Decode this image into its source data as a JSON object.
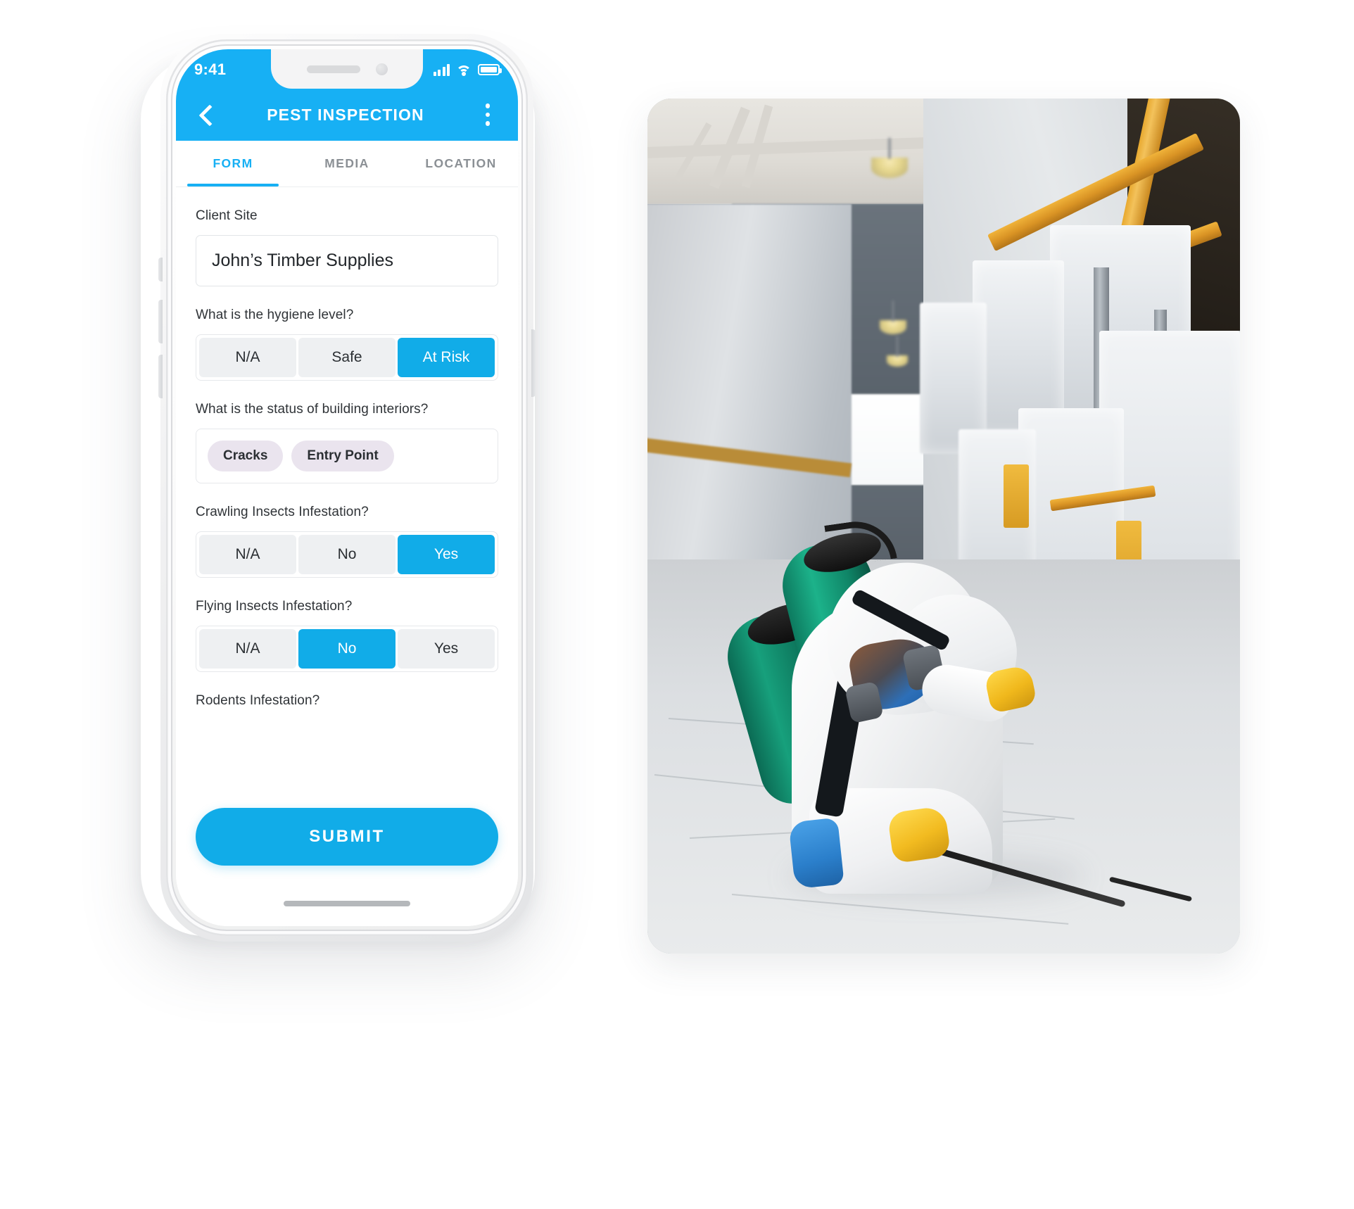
{
  "photo": {
    "alt_description": "Pest control worker in white protective coveralls, blue respirator mask and yellow gloves kneeling with a green sprayer tank, spraying along the base of pallet racking in a warehouse aisle",
    "scene": "warehouse-aisle",
    "colors": {
      "rack_yellow": "#e8a92f",
      "tank_green": "#17a07c",
      "glove_yellow": "#f2bb20",
      "mask_blue": "#2d6fb8",
      "floor_grey": "#dcdfe2"
    }
  },
  "phone": {
    "statusbar": {
      "time": "9:41",
      "icons": [
        "signal-bars-icon",
        "wifi-icon",
        "battery-icon"
      ]
    },
    "appbar": {
      "back_icon": "chevron-left-icon",
      "title": "PEST INSPECTION",
      "menu_icon": "kebab-menu-icon"
    },
    "tabs": [
      {
        "label": "FORM",
        "active": true
      },
      {
        "label": "MEDIA",
        "active": false
      },
      {
        "label": "LOCATION",
        "active": false
      }
    ],
    "form": {
      "fields": [
        {
          "type": "text",
          "label": "Client Site",
          "value": "John’s Timber Supplies",
          "placeholder": "Client Site"
        },
        {
          "type": "segmented",
          "label": "What is the hygiene level?",
          "options": [
            "N/A",
            "Safe",
            "At Risk"
          ],
          "selected": "At Risk"
        },
        {
          "type": "chips",
          "label": "What is the status of building interiors?",
          "chips": [
            "Cracks",
            "Entry Point"
          ]
        },
        {
          "type": "segmented",
          "label": "Crawling Insects Infestation?",
          "options": [
            "N/A",
            "No",
            "Yes"
          ],
          "selected": "Yes"
        },
        {
          "type": "segmented",
          "label": "Flying Insects Infestation?",
          "options": [
            "N/A",
            "No",
            "Yes"
          ],
          "selected": "No"
        },
        {
          "type": "label-only",
          "label": "Rodents Infestation?"
        }
      ],
      "submit_label": "SUBMIT"
    },
    "home_indicator": true
  },
  "theme": {
    "accent": "#17b0f4",
    "accent_fill": "#11ace8",
    "segment_bg": "#eef0f2",
    "chip_bg": "#eae4ee",
    "tab_inactive": "#8b9095",
    "text": "#2f3337"
  }
}
